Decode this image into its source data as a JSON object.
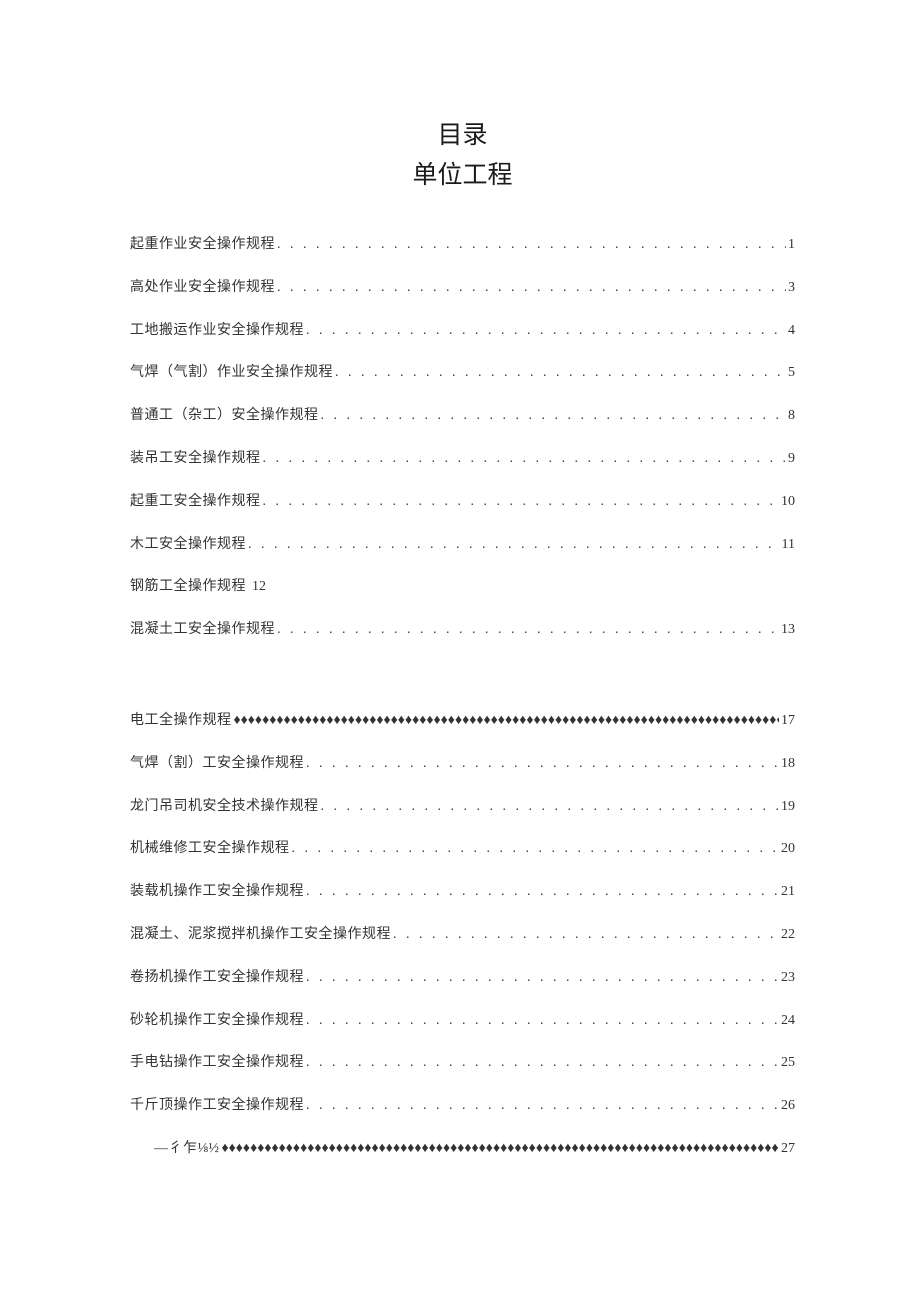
{
  "title_line1": "目录",
  "title_line2": "单位工程",
  "dot_leader": ". . . . . . . . . . . . . . . . . . . . . . . . . . . . . . . . . . . . . . . . . . . . . . . . . . . . . . . . . . . . . . . . . . . . . . . . . . . . . . . . . . . . . . . . . . . . . . . . . . . . . . . . . . . . . . . . . . . . . . . . . . . . . . . .",
  "diamond_leader": "♦♦♦♦♦♦♦♦♦♦♦♦♦♦♦♦♦♦♦♦♦♦♦♦♦♦♦♦♦♦♦♦♦♦♦♦♦♦♦♦♦♦♦♦♦♦♦♦♦♦♦♦♦♦♦♦♦♦♦♦♦♦♦♦♦♦♦♦♦♦♦♦♦♦♦♦♦♦♦♦♦♦♦♦♦♦♦♦♦♦♦♦♦♦♦♦♦♦♦♦",
  "toc": [
    {
      "title": "起重作业安全操作规程",
      "page": "1",
      "style": "dot",
      "indent": false
    },
    {
      "title": "高处作业安全操作规程",
      "page": "3",
      "style": "dot",
      "indent": false
    },
    {
      "title": "工地搬运作业安全操作规程",
      "page": "4",
      "style": "dot",
      "indent": false
    },
    {
      "title": "气焊（气割）作业安全操作规程",
      "page": "5",
      "style": "dot",
      "indent": false
    },
    {
      "title": "普通工（杂工）安全操作规程",
      "page": "8",
      "style": "dot",
      "indent": false
    },
    {
      "title": "装吊工安全操作规程",
      "page": "9",
      "style": "dot",
      "indent": false
    },
    {
      "title": "起重工安全操作规程",
      "page": "10",
      "style": "dot",
      "indent": false
    },
    {
      "title": "木工安全操作规程",
      "page": "11",
      "style": "dot",
      "indent": false
    },
    {
      "title": "钢筋工全操作规程",
      "page": "12",
      "style": "none",
      "indent": false
    },
    {
      "title": "混凝土工安全操作规程",
      "page": "13",
      "style": "dot",
      "indent": false
    },
    {
      "gap": true
    },
    {
      "title": "电工全操作规程",
      "page": "17",
      "style": "diamond",
      "indent": false
    },
    {
      "title": "气焊（割）工安全操作规程",
      "page": "18",
      "style": "dot",
      "indent": false
    },
    {
      "title": "龙门吊司机安全技术操作规程",
      "page": "19",
      "style": "dot",
      "indent": false
    },
    {
      "title": "机械维修工安全操作规程",
      "page": "20",
      "style": "dot",
      "indent": false
    },
    {
      "title": "装载机操作工安全操作规程",
      "page": "21",
      "style": "dot",
      "indent": false
    },
    {
      "title": "混凝土、泥浆搅拌机操作工安全操作规程",
      "page": "22",
      "style": "dot",
      "indent": false
    },
    {
      "title": "卷扬机操作工安全操作规程",
      "page": "23",
      "style": "dot",
      "indent": false
    },
    {
      "title": "砂轮机操作工安全操作规程",
      "page": "24",
      "style": "dot",
      "indent": false
    },
    {
      "title": "手电钻操作工安全操作规程",
      "page": "25",
      "style": "dot",
      "indent": false
    },
    {
      "title": "千斤顶操作工安全操作规程",
      "page": "26",
      "style": "dot",
      "indent": false
    },
    {
      "title": "—彳乍⅛½",
      "page": "27",
      "style": "diamond",
      "indent": true
    }
  ]
}
